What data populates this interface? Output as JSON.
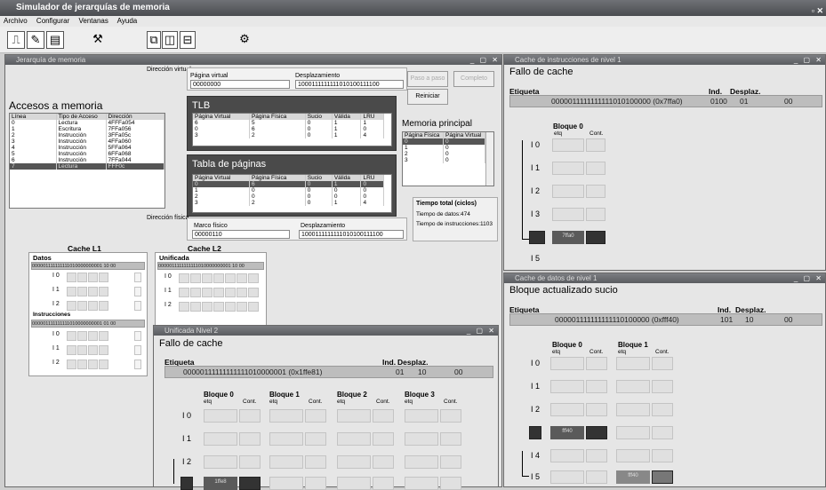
{
  "app": {
    "title": "Simulador de jerarquías de memoria"
  },
  "menu": [
    "Archivo",
    "Configurar",
    "Ventanas",
    "Ayuda"
  ],
  "main_window": {
    "title": "Jerarquía de memoria",
    "virtual_address": {
      "label": "Dirección virtual",
      "page_label": "Página virtual",
      "page_value": "00000000",
      "offset_label": "Desplazamiento",
      "offset_value": "1000111111111010100111100"
    },
    "buttons": {
      "step": "Paso a paso",
      "complete": "Completo",
      "reset": "Reiniciar"
    },
    "accesses": {
      "title": "Accesos a memoria",
      "headers": [
        "Línea",
        "Tipo de Acceso",
        "Dirección"
      ],
      "rows": [
        [
          "0",
          "Lectura",
          "4FFFa054"
        ],
        [
          "1",
          "Escritura",
          "7FFa056"
        ],
        [
          "2",
          "Instrucción",
          "3FFa05c"
        ],
        [
          "3",
          "Instrucción",
          "4FFa060"
        ],
        [
          "4",
          "Instrucción",
          "5FFa064"
        ],
        [
          "5",
          "Instrucción",
          "6FFa068"
        ],
        [
          "6",
          "Instrucción",
          "7FFa044"
        ],
        [
          "7",
          "Lectura",
          "FFF0c"
        ]
      ]
    },
    "tlb": {
      "title": "TLB",
      "headers": [
        "Página Virtual",
        "Página Física",
        "Sucio",
        "Válida",
        "LRU"
      ],
      "rows": [
        [
          "6",
          "5",
          "0",
          "1",
          "1"
        ],
        [
          "0",
          "6",
          "0",
          "1",
          "0"
        ],
        [
          "3",
          "2",
          "0",
          "1",
          "4"
        ]
      ]
    },
    "page_table": {
      "title": "Tabla de páginas",
      "headers": [
        "Página Virtual",
        "Página Física",
        "Sucio",
        "Válida",
        "LRU"
      ],
      "rows": [
        [
          "0",
          "6",
          "0",
          "1",
          "0"
        ],
        [
          "1",
          "0",
          "0",
          "0",
          "0"
        ],
        [
          "2",
          "0",
          "0",
          "0",
          "0"
        ],
        [
          "3",
          "2",
          "0",
          "1",
          "4"
        ]
      ]
    },
    "main_memory": {
      "title": "Memoria principal",
      "headers": [
        "Página Física",
        "Página Virtual"
      ],
      "rows": [
        [
          "0",
          "0"
        ],
        [
          "1",
          "0"
        ],
        [
          "2",
          "0"
        ],
        [
          "3",
          "0"
        ]
      ]
    },
    "physical_address": {
      "label": "Dirección física",
      "frame_label": "Marco físico",
      "frame_value": "00000110",
      "offset_label": "Desplazamiento",
      "offset_value": "1000111111111010100111100"
    },
    "time": {
      "title": "Tiempo total (ciclos)",
      "data": "Tiempo de datos:474",
      "instr": "Tiempo de instrucciones:1103"
    },
    "l1": {
      "title": "Cache L1",
      "data_label": "Datos",
      "data_addr": "000001111111111010000000001 10 00",
      "instr_label": "Instrucciones",
      "instr_addr": "000001111111111010000000001 01 00",
      "rows": [
        "I 0",
        "I 1",
        "I 2"
      ]
    },
    "l2": {
      "title": "Cache L2",
      "unified_label": "Unificada",
      "addr": "0000011111111111010000000001 10 00",
      "rows": [
        "I 0",
        "I 1",
        "I 2"
      ]
    }
  },
  "icache_window": {
    "title": "Cache de instrucciones de nivel 1",
    "status": "Fallo de cache",
    "tag_label": "Etiqueta",
    "ind_label": "Ind.",
    "desp_label": "Desplaz.",
    "tag_value": "0000011111111111010100000 (0x7ffa0)",
    "ind_value": "0100",
    "desp_value": "01",
    "byte_value": "00",
    "block_title": "Bloque 0",
    "etq": "etq",
    "cont": "Cont.",
    "rows": [
      "I 0",
      "I 1",
      "I 2",
      "I 3",
      "I 4",
      "I 5"
    ],
    "highlight_text": "7ffa0"
  },
  "dcache_window": {
    "title": "Cache de datos de nivel 1",
    "status": "Bloque actualizado sucio",
    "tag_label": "Etiqueta",
    "ind_label": "Ind.",
    "desp_label": "Desplaz.",
    "tag_value": "000001111111111110100000 (0xfff40)",
    "ind_value": "101",
    "desp_value": "10",
    "byte_value": "00",
    "block0_title": "Bloque 0",
    "block1_title": "Bloque 1",
    "etq": "etq",
    "cont": "Cont.",
    "rows": [
      "I 0",
      "I 1",
      "I 2",
      "I 3",
      "I 4",
      "I 5"
    ],
    "highlight_text": "fff40",
    "highlight_text2": "fff40"
  },
  "l2_window": {
    "title": "Unificada Nivel 2",
    "status": "Fallo de cache",
    "tag_label": "Etiqueta",
    "ind_label": "Ind.",
    "desp_label": "Desplaz.",
    "tag_value": "00000111111111111010000001 (0x1ffe81)",
    "ind_value": "01",
    "desp_value": "10",
    "byte_value": "00",
    "blocks": [
      "Bloque 0",
      "Bloque 1",
      "Bloque 2",
      "Bloque 3"
    ],
    "etq": "etq",
    "cont": "Cont.",
    "rows": [
      "I 0",
      "I 1",
      "I 2",
      "I 3"
    ],
    "highlight_text": "1ffe8"
  }
}
